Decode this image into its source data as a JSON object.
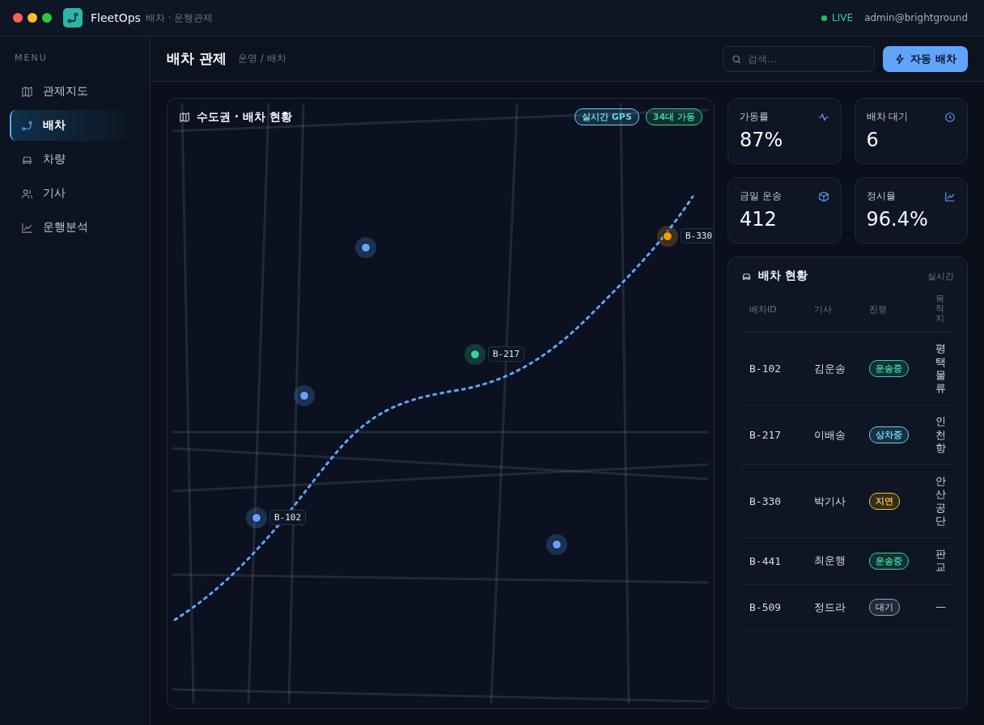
{
  "window": {
    "app_name": "FleetOps",
    "subtitle": "배차 · 운행관제",
    "status": "LIVE",
    "user": "admin@brightground"
  },
  "sidebar": {
    "heading": "MENU",
    "items": [
      {
        "label": "관제지도",
        "selected": false
      },
      {
        "label": "배차",
        "selected": true
      },
      {
        "label": "차량",
        "selected": false
      },
      {
        "label": "기사",
        "selected": false
      },
      {
        "label": "운행분석",
        "selected": false
      }
    ]
  },
  "header": {
    "title": "배차 관제",
    "breadcrumb": "운영 / 배차",
    "search": {
      "placeholder": "검색…"
    },
    "action": "자동 배차"
  },
  "map": {
    "title": "수도권 · 배차 현황",
    "badges": [
      {
        "label": "실시간 GPS",
        "color": "#67d3f0"
      },
      {
        "label": "34대 가동",
        "color": "#34d399"
      }
    ],
    "markers": [
      {
        "color": "#60a5fa"
      },
      {
        "label": "B-217",
        "color": "#34d399"
      },
      {
        "label": "B-330",
        "color": "#f59e0b"
      },
      {
        "color": "#60a5fa"
      },
      {
        "label": "B-102",
        "color": "#60a5fa"
      },
      {
        "color": "#60a5fa"
      }
    ]
  },
  "kpis": [
    {
      "label": "가동률",
      "value": "87%"
    },
    {
      "label": "배차 대기",
      "value": "6"
    },
    {
      "label": "금일 운송",
      "value": "412"
    },
    {
      "label": "정시율",
      "value": "96.4%"
    }
  ],
  "dispatch": {
    "title": "배차 현황",
    "note": "실시간",
    "columns": [
      "배차ID",
      "기사",
      "진행",
      "목적지"
    ],
    "rows": [
      {
        "id": "B-102",
        "driver": "김운송",
        "status": "운송중",
        "color": "#34d399",
        "destination": "평택물류"
      },
      {
        "id": "B-217",
        "driver": "이배송",
        "status": "상차중",
        "color": "#67d3f0",
        "destination": "인천항"
      },
      {
        "id": "B-330",
        "driver": "박기사",
        "status": "지연",
        "color": "#fbbf24",
        "destination": "안산공단"
      },
      {
        "id": "B-441",
        "driver": "최운행",
        "status": "운송중",
        "color": "#34d399",
        "destination": "판교"
      },
      {
        "id": "B-509",
        "driver": "정드라",
        "status": "대기",
        "color": "#94a3b8",
        "destination": "—"
      }
    ]
  }
}
